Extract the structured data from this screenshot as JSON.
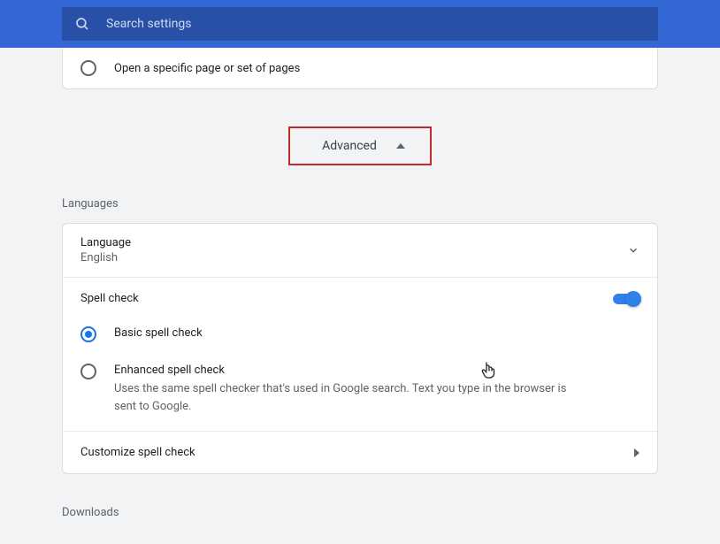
{
  "search": {
    "placeholder": "Search settings"
  },
  "startup": {
    "open_specific": "Open a specific page or set of pages"
  },
  "advanced": {
    "label": "Advanced"
  },
  "sections": {
    "languages_title": "Languages",
    "downloads_title": "Downloads"
  },
  "language": {
    "label": "Language",
    "value": "English"
  },
  "spellcheck": {
    "label": "Spell check",
    "enabled": true,
    "basic": {
      "title": "Basic spell check"
    },
    "enhanced": {
      "title": "Enhanced spell check",
      "desc": "Uses the same spell checker that's used in Google search. Text you type in the browser is sent to Google."
    },
    "customize": "Customize spell check"
  }
}
